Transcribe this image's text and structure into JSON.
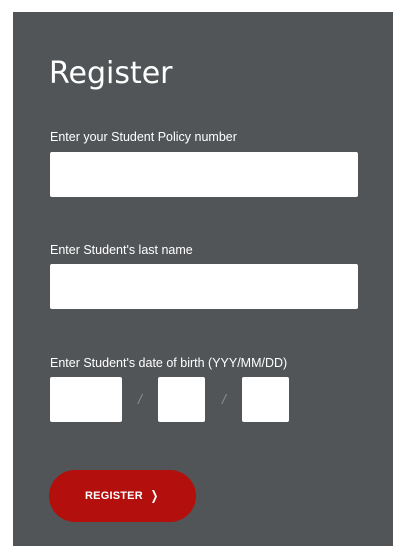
{
  "form": {
    "title": "Register",
    "policy_label": "Enter your Student Policy number",
    "policy_value": "",
    "last_name_label": "Enter Student's last name",
    "last_name_value": "",
    "dob_label": "Enter Student's date of birth (YYY/MM/DD)",
    "dob_year_value": "",
    "dob_month_value": "",
    "dob_day_value": "",
    "dob_separator": "/",
    "register_label": "REGISTER",
    "register_icon": "chevron-right-icon",
    "register_glyph": "❯"
  },
  "colors": {
    "panel_background": "#525557",
    "button_background": "#b30f0d",
    "text": "#ffffff"
  }
}
